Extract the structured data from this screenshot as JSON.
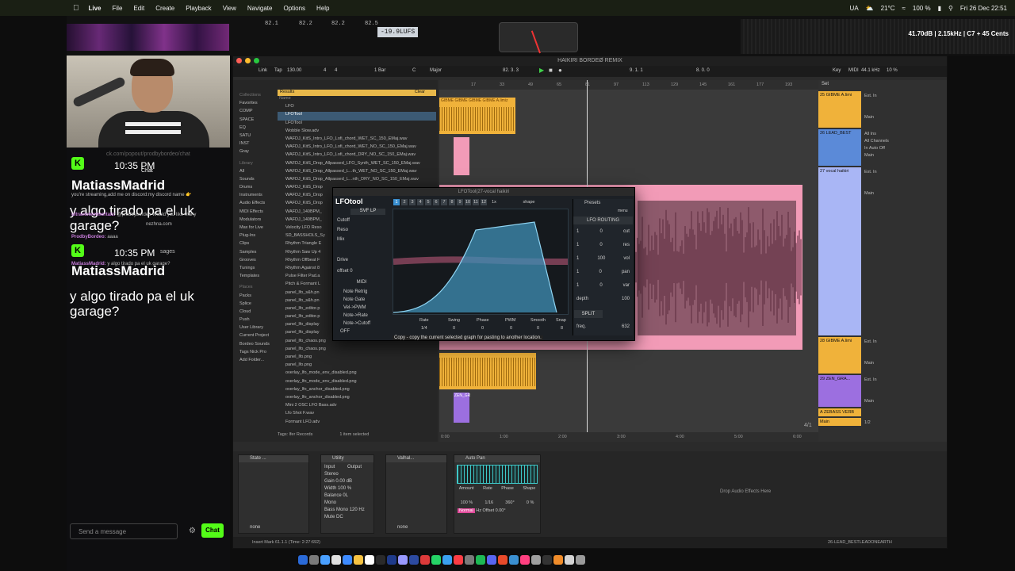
{
  "menubar": {
    "apple": "",
    "app": "Live",
    "menus": [
      "File",
      "Edit",
      "Create",
      "Playback",
      "View",
      "Navigate",
      "Options",
      "Help"
    ],
    "status": {
      "weather": "21°C",
      "battery": "100 %",
      "datetime": "Fri 26 Dec 22:51",
      "lang": "UA"
    }
  },
  "meters": {
    "lufs": "-19.9LUFS",
    "nums": [
      "82.1",
      "82.2",
      "82.2",
      "82.5"
    ],
    "readout": "41.70dB | 2.15kHz | C7 + 45 Cents"
  },
  "chat": {
    "url": "ck.com/popout/prodbybordeo/chat",
    "messages": [
      {
        "time": "10:35 PM",
        "label": "Chat",
        "user": "MatiassMadrid",
        "text": "y algo tirado pa el uk garage?"
      },
      {
        "time": "10:35 PM",
        "label": "sages",
        "user": "MatiassMadrid",
        "text": "y algo tirado pa el uk garage?"
      }
    ],
    "small": [
      {
        "user": "",
        "text": "you're streaming,add me on discord:my discord name 👉"
      },
      {
        "user": "ultraviolentmortalz:",
        "text": "@prodbybordeo Would you like many"
      },
      {
        "user": "",
        "text": "nezhna.com"
      },
      {
        "user": "ProdbyBordeo:",
        "text": "aaaa"
      },
      {
        "user": "MatiassMadrid:",
        "text": "y algo tirado pa el uk garage?"
      }
    ],
    "input_placeholder": "Send a message",
    "send_label": "Chat"
  },
  "live": {
    "title": "HAIKIRI BORDEØ REMIX",
    "transport": {
      "link": "Link",
      "tap": "Tap",
      "tempo": "130.00",
      "sig_num": "4",
      "sig_den": "4",
      "quant": "1 Bar",
      "key": "C",
      "scale": "Major",
      "position": "82. 3. 3",
      "loop_start": "9. 1. 1",
      "loop_len": "8. 0. 0",
      "key_label": "Key",
      "midi": "MIDI",
      "sample_rate": "44.1 kHz",
      "cpu": "10 %"
    },
    "browser": {
      "search": "lfo",
      "places": [
        "Collections",
        "Favorites",
        "COMP",
        "SPACE",
        "EQ",
        "SATU",
        "INST",
        "Gray",
        "Library",
        "All",
        "Sounds",
        "Drums",
        "Instruments",
        "Audio Effects",
        "MIDI Effects",
        "Modulators",
        "Max for Live",
        "Plug-Ins",
        "Clips",
        "Samples",
        "Grooves",
        "Tunings",
        "Templates",
        "Places",
        "Packs",
        "Splice",
        "Cloud",
        "Push",
        "User Library",
        "Current Project",
        "Bordeo Sounds",
        "Tags Nick Pro",
        "Add Folder..."
      ],
      "results_label": "Results",
      "clear": "Clear",
      "name_col": "Name",
      "rows": [
        "LFO",
        "LFOTool",
        "LFOTool",
        "Wobble Slow.adv",
        "WAFDJ_KitS_Intro_LFO_Lofi_chord_WET_SC_150_EMaj.wav",
        "WAFDJ_KitS_Intro_LFO_Lofi_chord_WET_NO_SC_150_EMaj.wav",
        "WAFDJ_KitS_Intro_LFO_Lofi_chord_DRY_NO_SC_150_EMaj.wav",
        "WAFDJ_KitS_Drop_Allpassed_LFO_Synth_WET_SC_150_EMaj.wav",
        "WAFDJ_KitS_Drop_Allpassed_L...th_WET_NO_SC_150_EMaj.wav",
        "WAFDJ_KitS_Drop_Allpassed_L...nth_DRY_NO_SC_150_EMaj.wav",
        "WAFDJ_KitS_Drop",
        "WAFDJ_KitS_Drop",
        "WAFDJ_KitS_Drop",
        "WAFDJ_140BPM_",
        "WAFDJ_140BPM_",
        "Velocity LFO Reso",
        "SD_BASSHOLS_Sy",
        "Rhythm Triangle E",
        "Rhythm Saw Up 4",
        "Rhythm Offbeat F",
        "Rhythm Against 8",
        "Pulse Filter Pad.a",
        "Pitch & Formant L",
        "panel_lfo_s&h.pn",
        "panel_lfo_s&h.pn",
        "panel_lfo_editor.p",
        "panel_lfo_editor.p",
        "panel_lfo_display",
        "panel_lfo_display",
        "panel_lfo_chaos.png",
        "panel_lfo_chaos.png",
        "panel_lfo.png",
        "panel_lfo.png",
        "overlay_lfo_mode_env_disabled.png",
        "overlay_lfo_mode_env_disabled.png",
        "overlay_lfo_anchor_disabled.png",
        "overlay_lfo_anchor_disabled.png",
        "Mini 2 OSC LFO Bass.adv",
        "Lfo Shot F.wav",
        "Formant LFO.adv"
      ],
      "tags": "Tags: lfer Records",
      "selected": "1 item selected"
    },
    "ruler": [
      "17",
      "33",
      "49",
      "65",
      "81",
      "97",
      "113",
      "129",
      "145",
      "161",
      "177",
      "193"
    ],
    "time_ruler": [
      "0:00",
      "1:00",
      "2:00",
      "3:00",
      "4:00",
      "5:00",
      "6:00"
    ],
    "fraction": "4/1",
    "set": "Set",
    "tracks": [
      {
        "name": "25 GIBME A.limi",
        "color": "#f0b23a",
        "input": "Ext. In",
        "routing": "Main"
      },
      {
        "name": "26 LEAD_BEST",
        "color": "#5b8ad8",
        "input": "All Ins",
        "channel": "All Channels",
        "routing": "Main",
        "monitor": [
          "In",
          "Auto",
          "Off"
        ]
      },
      {
        "name": "27 vocal haikiri",
        "color": "#a9b6f5",
        "input": "Ext. In",
        "routing": "Main"
      },
      {
        "name": "28 GIBME A.limi",
        "color": "#f0b23a",
        "input": "Ext. In",
        "routing": "Main"
      },
      {
        "name": "29 ZEN_GRA...",
        "color": "#9c6fe0",
        "input": "Ext. In",
        "routing": "Main"
      },
      {
        "name": "A ZEBASS VERB",
        "color": "#f0b23a"
      },
      {
        "name": "Main",
        "color": "#f0b23a",
        "sends": "1/2"
      }
    ],
    "clips": {
      "gibme": "GIBME GIBME GIBME GIBME A.limiz",
      "zen": "ZEN_GR"
    },
    "devices": [
      {
        "name": "State ...",
        "label": "none"
      },
      {
        "name": "Utility",
        "input": "Input",
        "output": "Output",
        "mode": "Stereo",
        "gain": "Gain",
        "gain_val": "0.00 dB",
        "width": "Width",
        "width_val": "100 %",
        "balance": "Balance",
        "balance_val": "0L",
        "mono": "Mono",
        "bass_mono": "Bass Mono",
        "bass_freq": "120 Hz",
        "mute": "Mute",
        "dc": "DC"
      },
      {
        "name": "Valhal...",
        "label": "none"
      },
      {
        "name": "Auto Pan",
        "amount": "Amount",
        "amount_val": "100 %",
        "rate": "Rate",
        "rate_val": "1/16",
        "phase": "Phase",
        "phase_val": "360°",
        "shape": "Shape",
        "shape_val": "0 %",
        "offset": "Offset",
        "offset_val": "0.00°",
        "mode": "Normal",
        "hz": "Hz"
      }
    ],
    "drop_fx": "Drop Audio Effects Here",
    "status": {
      "left": "Insert Mark 61.1.1 (Time: 2:27:692)",
      "right": "26-LEAD_BESTLEADONEARTH"
    }
  },
  "lfotool": {
    "title": "LFOTool(27-vocal haikiri",
    "logo": "LFOtool",
    "filter": "SVF LP",
    "left_labels": [
      "Cutoff",
      "Reso",
      "Mix",
      "Drive"
    ],
    "offset": "offset",
    "offset_val": "0",
    "midi": "MIDI",
    "midi_opts": [
      "Note Retrig",
      "Note Gate",
      "Vel->PWM",
      "Note->Rate",
      "Note->Cutoff"
    ],
    "tabs": [
      "1",
      "2",
      "3",
      "4",
      "5",
      "6",
      "7",
      "8",
      "9",
      "10",
      "11",
      "12"
    ],
    "zoom": "1x",
    "shape": "shape",
    "knobs": [
      "Rate",
      "Swing",
      "Phase",
      "PWM",
      "Smooth",
      "Snap"
    ],
    "knob_vals": [
      "1/4",
      "0",
      "0",
      "0",
      "0",
      "8"
    ],
    "presets": "Presets",
    "menu": "menu",
    "routing_title": "LFO ROUTING",
    "routing": [
      {
        "ch": "1",
        "label": "cut",
        "val": "0"
      },
      {
        "ch": "1",
        "label": "res",
        "val": "0"
      },
      {
        "ch": "1",
        "label": "vol",
        "val": "100"
      },
      {
        "ch": "1",
        "label": "pan",
        "val": "0"
      },
      {
        "ch": "1",
        "label": "var",
        "val": "0"
      }
    ],
    "depth": "depth",
    "depth_val": "100",
    "split": "SPLIT",
    "freq": "freq.",
    "freq_val": "632",
    "tooltip": "Copy - copy the current selected graph for pasting to another location.",
    "off": "OFF"
  }
}
